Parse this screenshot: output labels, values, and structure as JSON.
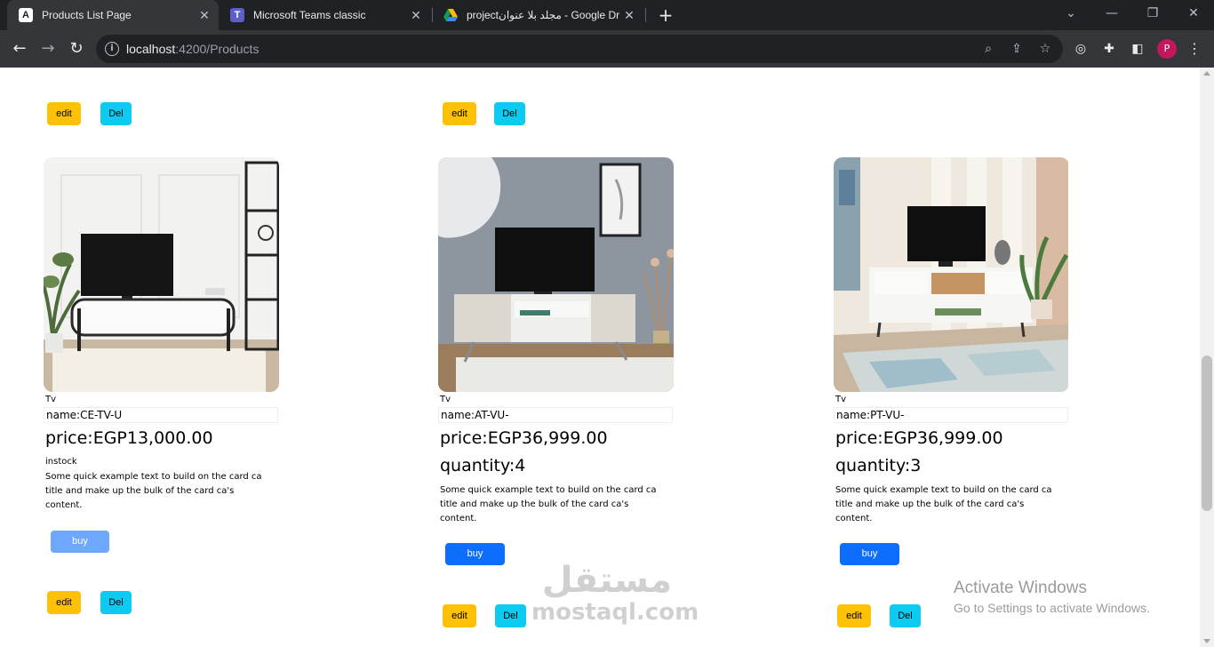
{
  "browser": {
    "tabs": [
      {
        "title": "Products List Page",
        "active": true,
        "icon": "angular-icon"
      },
      {
        "title": "Microsoft Teams classic",
        "active": false,
        "icon": "teams-icon"
      },
      {
        "title": "projectمجلد بلا عنوان - Google Dr",
        "active": false,
        "icon": "google-drive-icon"
      }
    ],
    "url_host": "localhost",
    "url_path": ":4200/Products"
  },
  "page": {
    "top_row": [
      {
        "edit_label": "edit",
        "del_label": "Del"
      },
      {
        "edit_label": "edit",
        "del_label": "Del"
      }
    ],
    "products": [
      {
        "category": "Tv",
        "name": "name:CE-TV-U",
        "price": "price:EGP13,000.00",
        "quantity": "",
        "stock": "instock",
        "description": "Some quick example text to build on the card ca title and make up the bulk of the card ca's content.",
        "buy_label": "buy",
        "buy_disabled": true,
        "edit_label": "edit",
        "del_label": "Del"
      },
      {
        "category": "Tv",
        "name": "name:AT-VU-",
        "price": "price:EGP36,999.00",
        "quantity": "quantity:4",
        "stock": "",
        "description": "Some quick example text to build on the card ca title and make up the bulk of the card ca's content.",
        "buy_label": "buy",
        "buy_disabled": false,
        "edit_label": "edit",
        "del_label": "Del"
      },
      {
        "category": "Tv",
        "name": "name:PT-VU-",
        "price": "price:EGP36,999.00",
        "quantity": "quantity:3",
        "stock": "",
        "description": "Some quick example text to build on the card ca title and make up the bulk of the card ca's content.",
        "buy_label": "buy",
        "buy_disabled": false,
        "edit_label": "edit",
        "del_label": "Del"
      }
    ]
  },
  "overlay": {
    "activate_title": "Activate Windows",
    "activate_sub": "Go to Settings to activate Windows.",
    "watermark_ar": "مستقل",
    "watermark_en": "mostaql.com"
  }
}
